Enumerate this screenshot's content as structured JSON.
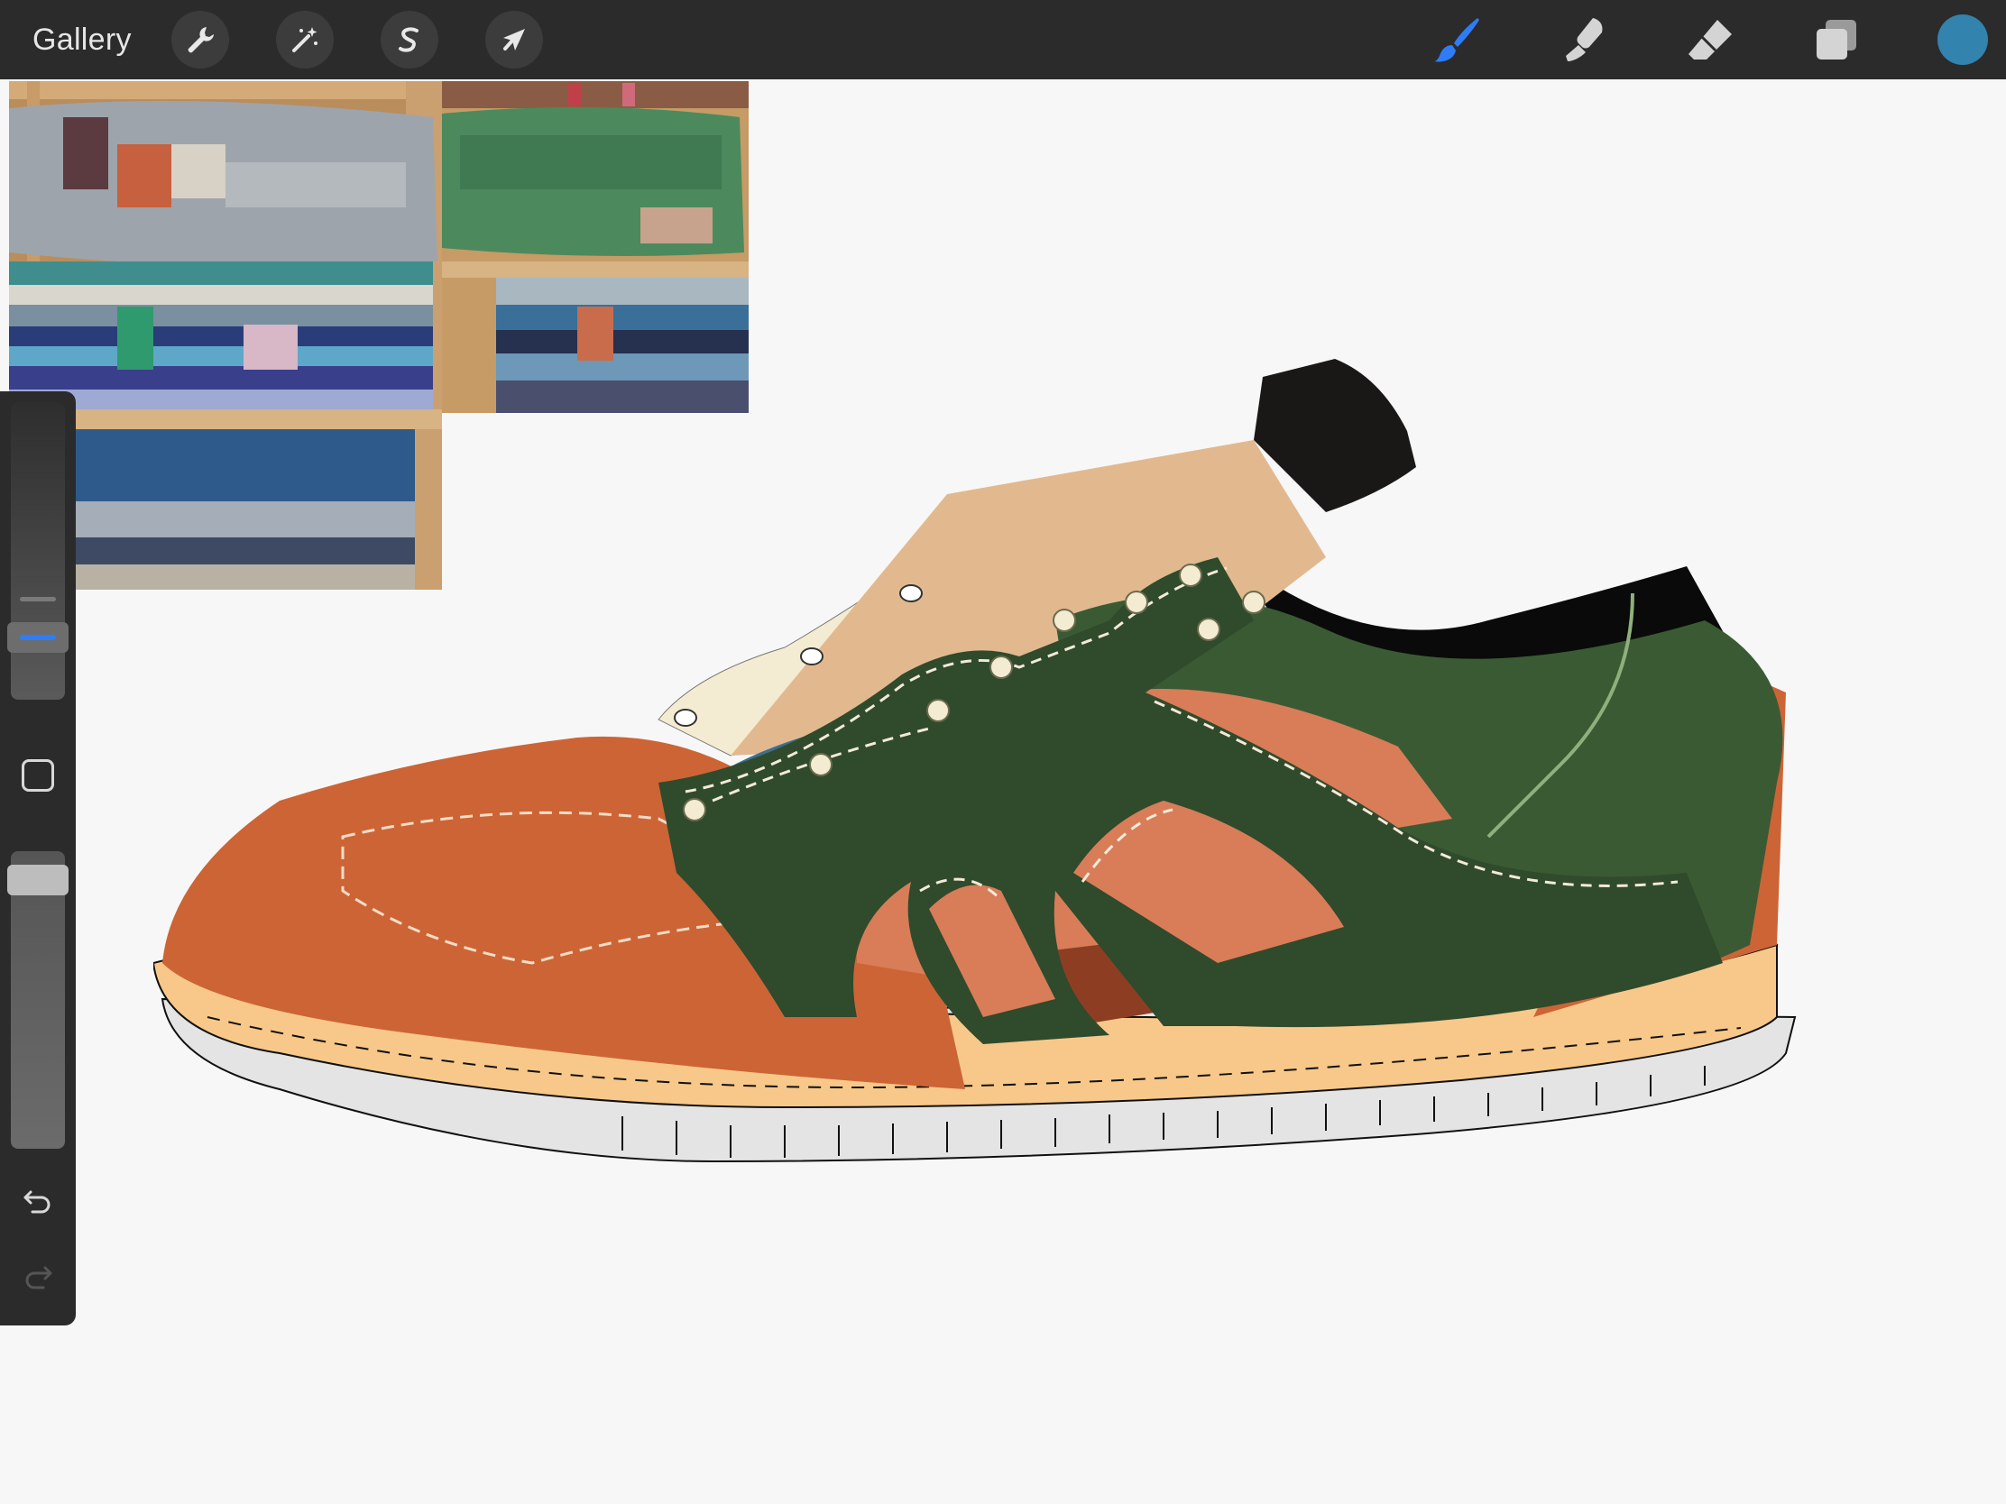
{
  "toolbar": {
    "gallery_label": "Gallery",
    "left_tools": [
      {
        "name": "actions",
        "icon": "wrench-icon"
      },
      {
        "name": "adjustments",
        "icon": "magic-wand-icon"
      },
      {
        "name": "selection",
        "icon": "selection-s-icon"
      },
      {
        "name": "transform",
        "icon": "arrow-cursor-icon"
      }
    ],
    "right_tools": [
      {
        "name": "brush",
        "icon": "brush-icon",
        "active": true
      },
      {
        "name": "smudge",
        "icon": "smudge-icon",
        "active": false
      },
      {
        "name": "eraser",
        "icon": "eraser-icon",
        "active": false
      },
      {
        "name": "layers",
        "icon": "layers-icon",
        "active": false
      }
    ],
    "active_color": "#3283ad",
    "accent_color": "#2f7df6"
  },
  "sidebar": {
    "brush_size_level": 0.38,
    "opacity_level": 0.95,
    "undo_icon": "undo-icon",
    "redo_icon": "redo-icon"
  },
  "canvas": {
    "background": "#f7f7f7",
    "reference_images": [
      "folded-blankets-photo-1",
      "folded-blankets-photo-2"
    ],
    "artwork": "sneaker-illustration",
    "artwork_colors": {
      "orange": "#cd6436",
      "salmon": "#d87d58",
      "rust": "#8d3e22",
      "green": "#304a2c",
      "mid_green": "#3a5a34",
      "blue": "#3a6f8f",
      "tan": "#e2b98f",
      "cream": "#f4ecd2",
      "black": "#0a0a0a",
      "sole": "#f7c889",
      "tread": "#e4e4e4"
    }
  }
}
